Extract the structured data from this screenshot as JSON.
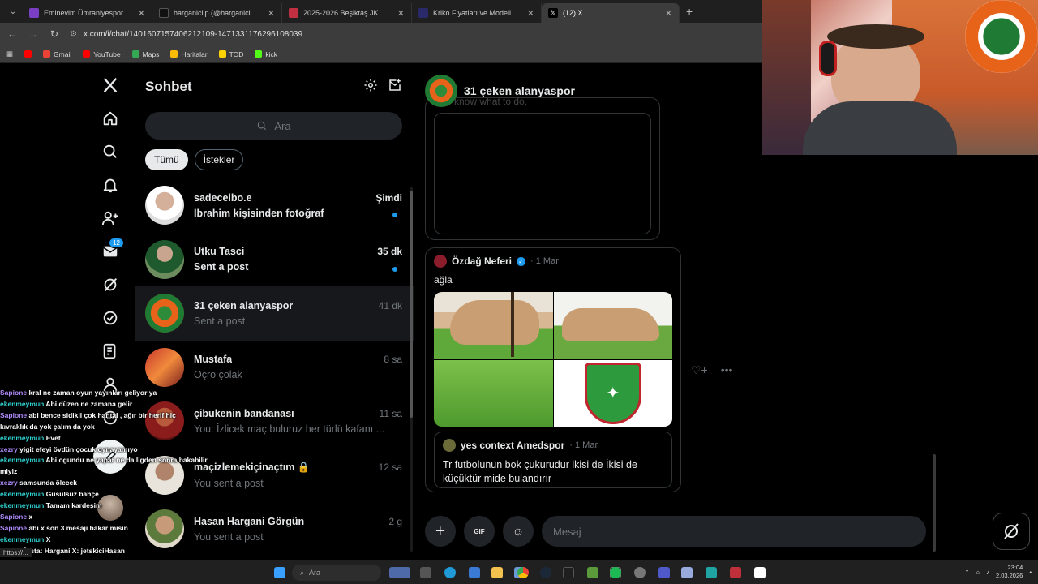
{
  "browser": {
    "tabs": [
      {
        "title": "Eminevim Ümraniyespor - Band",
        "color": "#7b3fc4"
      },
      {
        "title": "harganiclip (@harganiclip) | Tik",
        "color": "#111111"
      },
      {
        "title": "2025-2026 Beşiktaş JK Maaşları",
        "color": "#c03040"
      },
      {
        "title": "Kriko Fiyatları ve Modelleri | Tre",
        "color": "#2a2a6a"
      },
      {
        "title": "(12) X",
        "color": "#000000"
      }
    ],
    "url": "x.com/i/chat/1401607157406212109-1471331176296108039",
    "bookmarks": [
      {
        "label": "Gmail",
        "color": "#ea4335"
      },
      {
        "label": "YouTube",
        "color": "#ff0000"
      },
      {
        "label": "Maps",
        "color": "#34a853"
      },
      {
        "label": "Haritalar",
        "color": "#fbbc04"
      },
      {
        "label": "TOD",
        "color": "#ffd400"
      },
      {
        "label": "kick",
        "color": "#53fc18"
      }
    ]
  },
  "nav": {
    "messages_badge": "12"
  },
  "chat_list": {
    "title": "Sohbet",
    "search_placeholder": "Ara",
    "filters": [
      "Tümü",
      "İstekler"
    ],
    "conversations": [
      {
        "name": "sadeceibo.e",
        "time": "Şimdi",
        "preview": "İbrahim kişisinden fotoğraf",
        "unread": true
      },
      {
        "name": "Utku Tasci",
        "time": "35 dk",
        "preview": "Sent a post",
        "unread": true
      },
      {
        "name": "31 çeken alanyaspor",
        "time": "41 dk",
        "preview": "Sent a post",
        "unread": false
      },
      {
        "name": "Mustafa",
        "time": "8 sa",
        "preview": "Oçro çolak",
        "unread": false
      },
      {
        "name": "çibukenin bandanası",
        "time": "11 sa",
        "preview": "You: İzlicek maç buluruz her türlü kafanı ...",
        "unread": false
      },
      {
        "name": "maçizlemekiçinaçtım",
        "time": "12 sa",
        "preview": "You sent a post",
        "unread": false
      },
      {
        "name": "Hasan Hargani Görgün",
        "time": "2 g",
        "preview": "You sent a post",
        "unread": false
      }
    ]
  },
  "conversation": {
    "name": "31 çeken alanyaspor",
    "ghost": "know what to do.",
    "post": {
      "author": "Özdağ Neferi",
      "date": "· 1 Mar",
      "text": "ağla",
      "quote": {
        "author": "yes context Amedspor",
        "date": "· 1 Mar",
        "text": "Tr futbolunun bok çukurudur ikisi de İkisi de küçüktür mide bulandırır"
      }
    },
    "composer_placeholder": "Mesaj"
  },
  "stream_chat": [
    {
      "user": "Sapione",
      "color": "#b18cff",
      "msg": "kral ne zaman oyun yayınları geliyor ya"
    },
    {
      "user": "ekenmeymun",
      "color": "#2fd3d3",
      "msg": "Abi düzen ne zamana gelir"
    },
    {
      "user": "Sapione",
      "color": "#b18cff",
      "msg": "abi bence sidikli çok hantal , ağır bir herif hiç"
    },
    {
      "user": "",
      "color": "#ffffff",
      "msg": "kıvraklık da yok çalım da yok"
    },
    {
      "user": "ekenmeymun",
      "color": "#2fd3d3",
      "msg": "Evet"
    },
    {
      "user": "xezry",
      "color": "#b18cff",
      "msg": "yigit efeyi övdün çocuk oynayamıyo"
    },
    {
      "user": "ekenmeymun",
      "color": "#2fd3d3",
      "msg": "Abi ogundu ne yapar ne da ligden sonra bakabilir"
    },
    {
      "user": "",
      "color": "#ffffff",
      "msg": "miyiz"
    },
    {
      "user": "xezry",
      "color": "#b18cff",
      "msg": "samsunda ölecek"
    },
    {
      "user": "ekenmeymun",
      "color": "#2fd3d3",
      "msg": "Gusülsüz bahçe"
    },
    {
      "user": "ekenmeymun",
      "color": "#2fd3d3",
      "msg": "Tamam kardeşim"
    },
    {
      "user": "Sapione",
      "color": "#b18cff",
      "msg": "x"
    },
    {
      "user": "Sapione",
      "color": "#b18cff",
      "msg": "abi x son 3 mesajı bakar mısın"
    },
    {
      "user": "ekenmeymun",
      "color": "#2fd3d3",
      "msg": "X"
    },
    {
      "user": "BotRix",
      "color": "#53fc18",
      "msg": "İnsta: Hargani X: jetskiciHasan"
    }
  ],
  "status_url": "https://...",
  "taskbar": {
    "search_placeholder": "Ara",
    "time": "23:04",
    "date": "2.03.2026"
  }
}
